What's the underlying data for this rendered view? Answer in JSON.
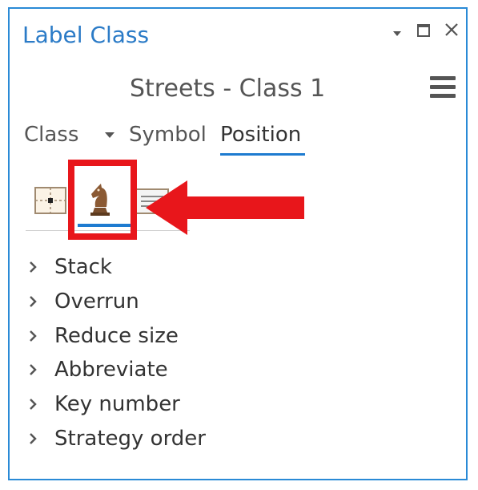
{
  "pane": {
    "title": "Label Class",
    "layer_class": "Streets - Class 1"
  },
  "tabs": [
    {
      "label": "Class",
      "has_dropdown": true
    },
    {
      "label": "Symbol"
    },
    {
      "label": "Position",
      "active": true
    }
  ],
  "position_subtabs": [
    {
      "icon": "placement-icon"
    },
    {
      "icon": "chess-knight-icon",
      "active": true
    },
    {
      "icon": "label-layout-icon"
    }
  ],
  "sections": [
    {
      "label": "Stack"
    },
    {
      "label": "Overrun"
    },
    {
      "label": "Reduce size"
    },
    {
      "label": "Abbreviate"
    },
    {
      "label": "Key number"
    },
    {
      "label": "Strategy order"
    }
  ],
  "colors": {
    "accent": "#1e7bd0",
    "title": "#2b7bc7",
    "annotation_red": "#e8161b"
  }
}
